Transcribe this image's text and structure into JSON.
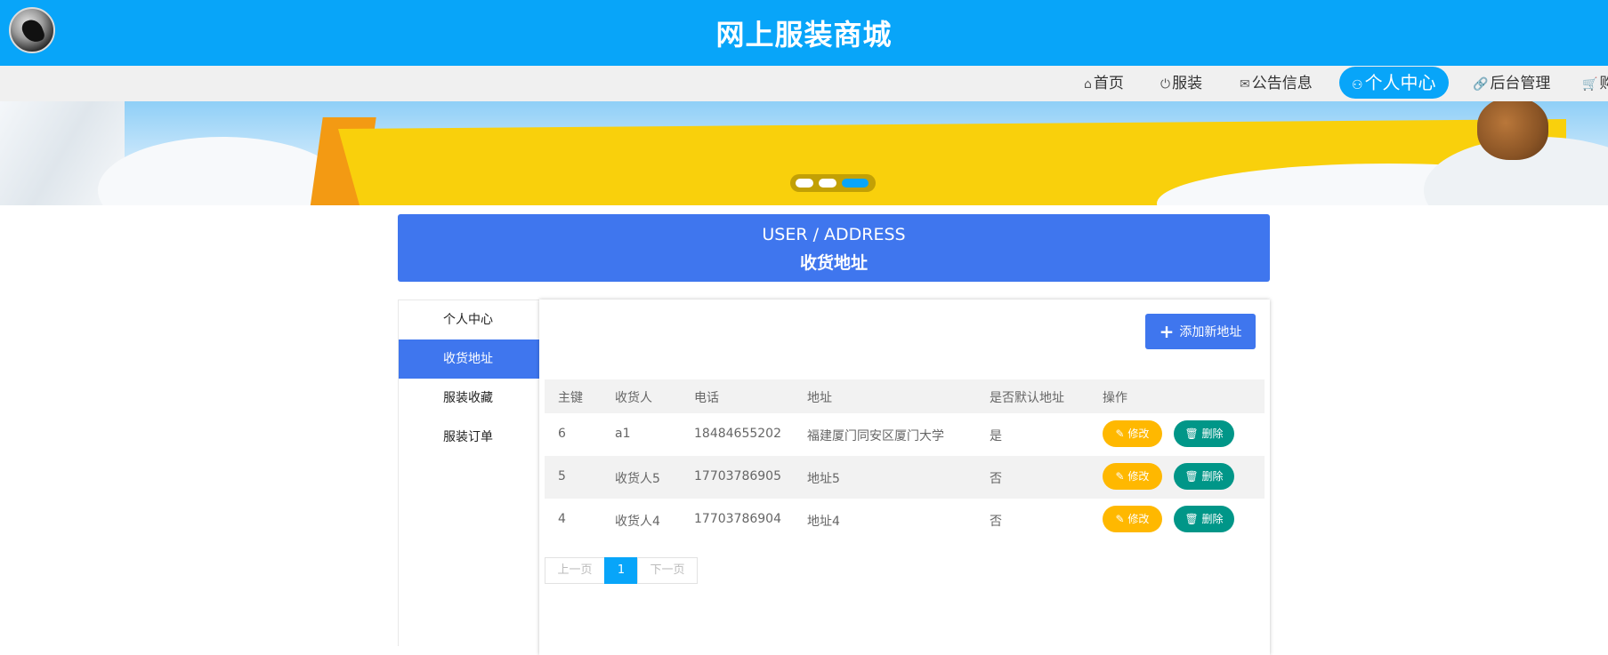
{
  "header": {
    "title": "网上服装商城"
  },
  "nav": [
    {
      "icon": "⌂",
      "label": "首页"
    },
    {
      "icon": "⏻",
      "label": "服装"
    },
    {
      "icon": "✉",
      "label": "公告信息"
    },
    {
      "icon": "⚇",
      "label": "个人中心"
    },
    {
      "icon": "🔗",
      "label": "后台管理"
    },
    {
      "icon": "🛒",
      "label": "购"
    }
  ],
  "panel": {
    "title_en": "USER / ADDRESS",
    "title_cn": "收货地址"
  },
  "sidebar": [
    {
      "label": "个人中心"
    },
    {
      "label": "收货地址"
    },
    {
      "label": "服装收藏"
    },
    {
      "label": "服装订单"
    }
  ],
  "toolbar": {
    "add_label": "添加新地址"
  },
  "table": {
    "headers": [
      "主键",
      "收货人",
      "电话",
      "地址",
      "是否默认地址",
      "操作"
    ],
    "rows": [
      {
        "id": "6",
        "name": "a1",
        "phone": "18484655202",
        "address": "福建厦门同安区厦门大学",
        "default": "是"
      },
      {
        "id": "5",
        "name": "收货人5",
        "phone": "17703786905",
        "address": "地址5",
        "default": "否"
      },
      {
        "id": "4",
        "name": "收货人4",
        "phone": "17703786904",
        "address": "地址4",
        "default": "否"
      }
    ],
    "edit_label": "修改",
    "delete_label": "删除"
  },
  "pagination": {
    "prev": "上一页",
    "current": "1",
    "next": "下一页"
  }
}
